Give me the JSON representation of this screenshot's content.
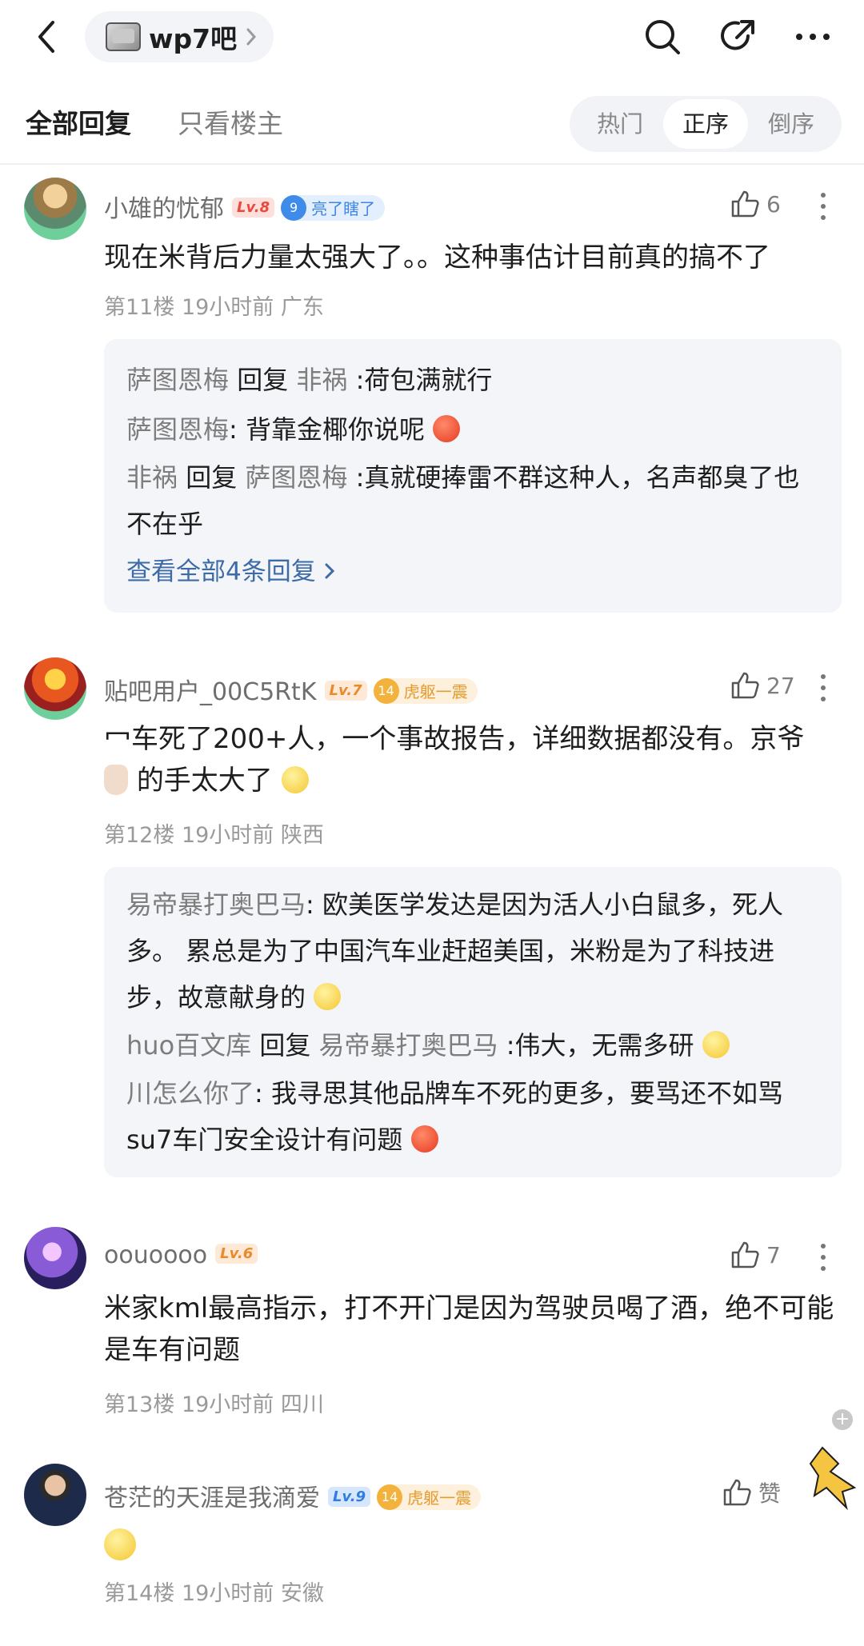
{
  "header": {
    "forum_name": "wp7吧",
    "icons": [
      "back-icon",
      "search-icon",
      "share-icon",
      "more-icon"
    ]
  },
  "filter": {
    "tab_all": "全部回复",
    "tab_op": "只看楼主",
    "sort": [
      "热门",
      "正序",
      "倒序"
    ],
    "active_sort": "正序"
  },
  "posts": [
    {
      "user": "小雄的忧郁",
      "level": "Lv.8",
      "badge_num": "9",
      "badge_text": "亮了瞎了",
      "likes": "6",
      "content": "现在米背后力量太强大了。。这种事估计目前真的搞不了",
      "meta": "第11楼 19小时前 广东",
      "replies": [
        {
          "from": "萨图恩梅",
          "verb": "回复",
          "to": "非祸",
          "text": ":荷包满就行"
        },
        {
          "from": "萨图恩梅",
          "text": ": 背靠金椰你说呢"
        },
        {
          "from": "非祸",
          "verb": "回复",
          "to": "萨图恩梅",
          "text": ":真就硬捧雷不群这种人，名声都臭了也不在乎"
        }
      ],
      "see_all": "查看全部4条回复"
    },
    {
      "user": "贴吧用户_00C5RtK",
      "level": "Lv.7",
      "badge_num": "14",
      "badge_text": "虎躯一震",
      "likes": "27",
      "content_line1": "冖车死了200+人，一个事故报告，详细数据都没有。京爷",
      "content_line2": "的手太大了",
      "meta": "第12楼 19小时前 陕西",
      "replies": [
        {
          "from": "易帝暴打奥巴马",
          "text": ": 欧美医学发达是因为活人小白鼠多，死人多。 累总是为了中国汽车业赶超美国，米粉是为了科技进步，故意献身的"
        },
        {
          "from": "huo百文库",
          "verb": "回复",
          "to": "易帝暴打奥巴马",
          "text": ":伟大，无需多研"
        },
        {
          "from": "川怎么你了",
          "text": ": 我寻思其他品牌车不死的更多，要骂还不如骂 su7车门安全设计有问题"
        }
      ]
    },
    {
      "user": "oouoooo",
      "level": "Lv.6",
      "likes": "7",
      "content": "米家kml最高指示，打不开门是因为驾驶员喝了酒，绝不可能是车有问题",
      "meta": "第13楼 19小时前 四川"
    },
    {
      "user": "苍茫的天涯是我滴爱",
      "level": "Lv.9",
      "badge_num": "14",
      "badge_text": "虎躯一震",
      "likes": "赞",
      "meta": "第14楼 19小时前 安徽"
    }
  ]
}
